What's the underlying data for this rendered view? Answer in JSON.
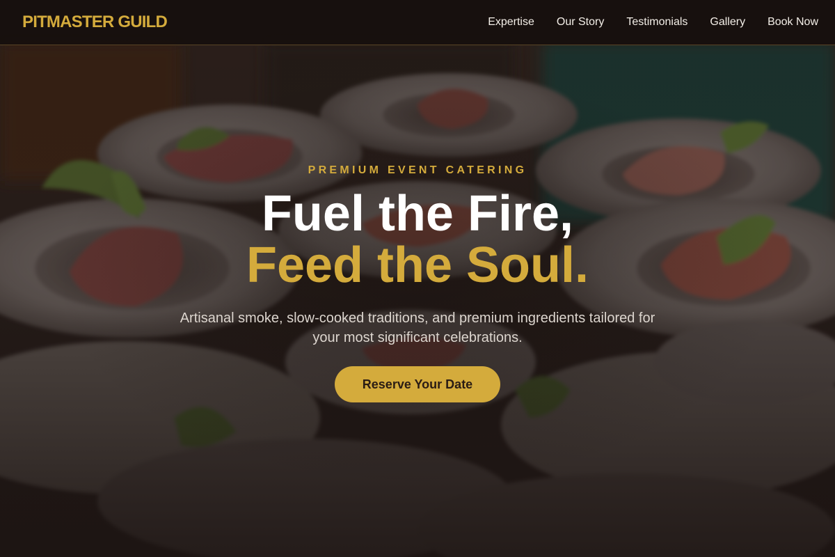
{
  "header": {
    "brand": "PITMASTER GUILD",
    "nav": [
      {
        "label": "Expertise"
      },
      {
        "label": "Our Story"
      },
      {
        "label": "Testimonials"
      },
      {
        "label": "Gallery"
      },
      {
        "label": "Book Now"
      }
    ]
  },
  "hero": {
    "eyebrow": "PREMIUM EVENT CATERING",
    "headline_line1": "Fuel the Fire,",
    "headline_line2": "Feed the Soul.",
    "lead": "Artisanal smoke, slow-cooked traditions, and premium ingredients tailored for your most significant celebrations.",
    "cta_label": "Reserve Your Date"
  },
  "colors": {
    "accent": "#d4ab3c",
    "header_bg": "#17100e",
    "text_light": "#f4efe8",
    "cta_text": "#2a1c14"
  }
}
